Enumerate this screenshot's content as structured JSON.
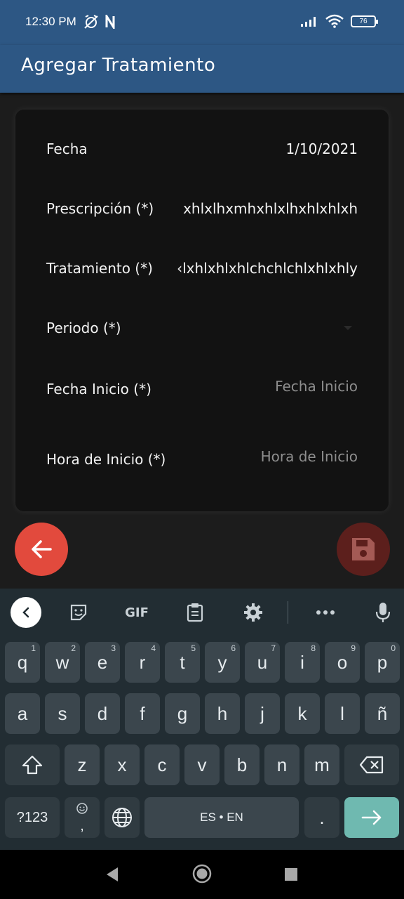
{
  "status_bar": {
    "time": "12:30 PM",
    "battery": "76"
  },
  "app_bar": {
    "title": "Agregar Tratamiento"
  },
  "form": {
    "fecha": {
      "label": "Fecha",
      "value": "1/10/2021"
    },
    "prescripcion": {
      "label": "Prescripción (*)",
      "value": "xhlxlhxmhxhlxlhxhlxhlxh"
    },
    "tratamiento": {
      "label": "Tratamiento (*)",
      "value": "‹lxhlxhlxhlchchlchlxhlxhly"
    },
    "periodo": {
      "label": "Periodo (*)"
    },
    "fecha_inicio": {
      "label": "Fecha Inicio (*)",
      "placeholder": "Fecha Inicio"
    },
    "hora_inicio": {
      "label": "Hora de Inicio (*)",
      "placeholder": "Hora de Inicio"
    }
  },
  "keyboard": {
    "toolbar": {
      "gif": "GIF"
    },
    "row1": [
      {
        "k": "q",
        "h": "1"
      },
      {
        "k": "w",
        "h": "2"
      },
      {
        "k": "e",
        "h": "3"
      },
      {
        "k": "r",
        "h": "4"
      },
      {
        "k": "t",
        "h": "5"
      },
      {
        "k": "y",
        "h": "6"
      },
      {
        "k": "u",
        "h": "7"
      },
      {
        "k": "i",
        "h": "8"
      },
      {
        "k": "o",
        "h": "9"
      },
      {
        "k": "p",
        "h": "0"
      }
    ],
    "row2": [
      "a",
      "s",
      "d",
      "f",
      "g",
      "h",
      "j",
      "k",
      "l",
      "ñ"
    ],
    "row3": [
      "z",
      "x",
      "c",
      "v",
      "b",
      "n",
      "m"
    ],
    "symbols": "?123",
    "emoji_comma": ",",
    "space": "ES • EN",
    "period": "."
  },
  "colors": {
    "app_bar": "#2d5784",
    "back_fab": "#e24a3d",
    "save_fab": "#5c1f1c",
    "enter_key": "#6fb9b0"
  }
}
